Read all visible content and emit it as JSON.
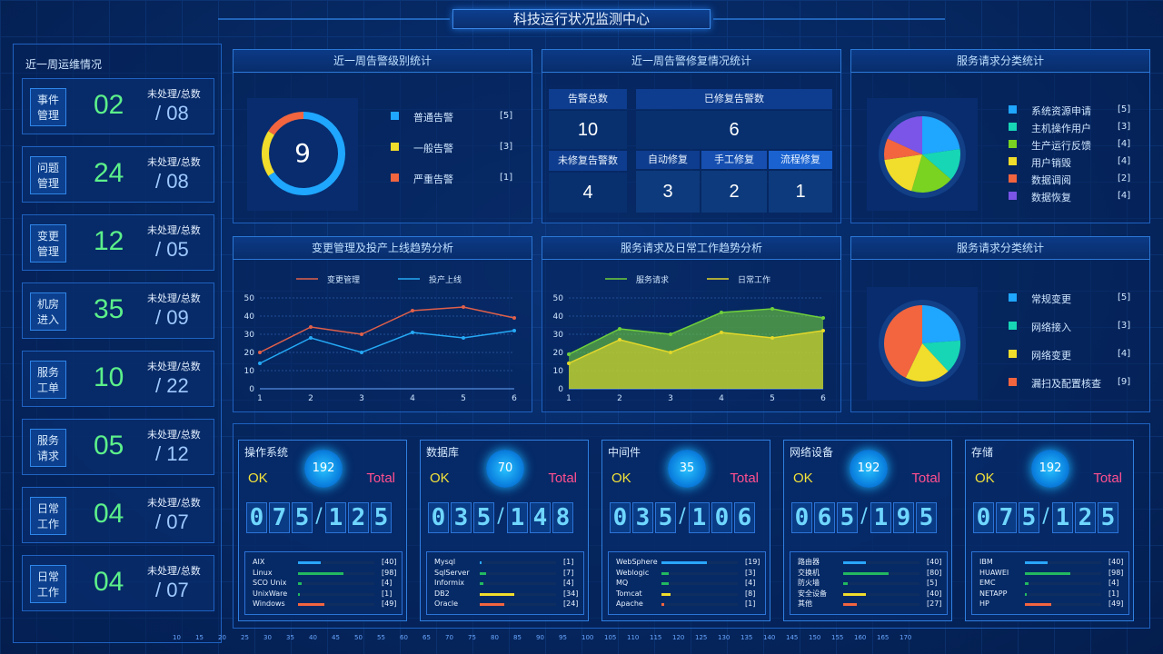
{
  "title": "科技运行状况监测中心",
  "ops": {
    "heading": "近一周运维情况",
    "items": [
      {
        "tag1": "事件",
        "tag2": "管理",
        "open": "02",
        "label": "未处理/总数",
        "total": "/ 08"
      },
      {
        "tag1": "问题",
        "tag2": "管理",
        "open": "24",
        "label": "未处理/总数",
        "total": "/ 08"
      },
      {
        "tag1": "变更",
        "tag2": "管理",
        "open": "12",
        "label": "未处理/总数",
        "total": "/ 05"
      },
      {
        "tag1": "机房",
        "tag2": "进入",
        "open": "35",
        "label": "未处理/总数",
        "total": "/ 09"
      },
      {
        "tag1": "服务",
        "tag2": "工单",
        "open": "10",
        "label": "未处理/总数",
        "total": "/ 22"
      },
      {
        "tag1": "服务",
        "tag2": "请求",
        "open": "05",
        "label": "未处理/总数",
        "total": "/ 12"
      },
      {
        "tag1": "日常",
        "tag2": "工作",
        "open": "04",
        "label": "未处理/总数",
        "total": "/ 07"
      },
      {
        "tag1": "日常",
        "tag2": "工作",
        "open": "04",
        "label": "未处理/总数",
        "total": "/ 07"
      }
    ]
  },
  "alarm_level": {
    "title": "近一周告警级别统计",
    "total": "9",
    "legend": [
      {
        "label": "普通告警",
        "count": "[5]",
        "color": "#1fa6ff"
      },
      {
        "label": "一般告警",
        "count": "[3]",
        "color": "#f1dd2b"
      },
      {
        "label": "严重告警",
        "count": "[1]",
        "color": "#f2653f"
      }
    ]
  },
  "repair": {
    "title": "近一周告警修复情况统计",
    "alarm_total_label": "告警总数",
    "alarm_total": "10",
    "repaired_label": "已修复告警数",
    "repaired": "6",
    "unrepaired_label": "未修复告警数",
    "unrepaired": "4",
    "auto_label": "自动修复",
    "auto": "3",
    "manual_label": "手工修复",
    "manual": "2",
    "flow_label": "流程修复",
    "flow": "1"
  },
  "service_cat1": {
    "title": "服务请求分类统计",
    "legend": [
      {
        "label": "系统资源申请",
        "count": "[5]",
        "color": "#1fa6ff"
      },
      {
        "label": "主机操作用户",
        "count": "[3]",
        "color": "#17d6b5"
      },
      {
        "label": "生产运行反馈",
        "count": "[4]",
        "color": "#7ad320"
      },
      {
        "label": "用户销毁",
        "count": "[4]",
        "color": "#f1dd2b"
      },
      {
        "label": "数据调阅",
        "count": "[2]",
        "color": "#f2653f"
      },
      {
        "label": "数据恢复",
        "count": "[4]",
        "color": "#7a55e8"
      }
    ]
  },
  "change_trend": {
    "title": "变更管理及投产上线趋势分析"
  },
  "service_trend": {
    "title": "服务请求及日常工作趋势分析"
  },
  "service_cat2": {
    "title": "服务请求分类统计",
    "legend": [
      {
        "label": "常规变更",
        "count": "[5]",
        "color": "#1fa6ff"
      },
      {
        "label": "网络接入",
        "count": "[3]",
        "color": "#17d6b5"
      },
      {
        "label": "网络变更",
        "count": "[4]",
        "color": "#f1dd2b"
      },
      {
        "label": "漏扫及配置核查",
        "count": "[9]",
        "color": "#f2653f"
      }
    ]
  },
  "chart_data": [
    {
      "type": "line",
      "title": "变更管理及投产上线趋势分析",
      "x": [
        1,
        2,
        3,
        4,
        5,
        6
      ],
      "ylim": [
        0,
        50
      ],
      "yticks": [
        0,
        10,
        20,
        30,
        40,
        50
      ],
      "series": [
        {
          "name": "变更管理",
          "values": [
            20,
            34,
            30,
            43,
            45,
            39
          ],
          "color": "#e0604a"
        },
        {
          "name": "投产上线",
          "values": [
            14,
            28,
            20,
            31,
            28,
            32
          ],
          "color": "#25a9f5"
        }
      ],
      "legend": "top"
    },
    {
      "type": "area",
      "title": "服务请求及日常工作趋势分析",
      "x": [
        1,
        2,
        3,
        4,
        5,
        6
      ],
      "ylim": [
        0,
        50
      ],
      "yticks": [
        0,
        10,
        20,
        30,
        40,
        50
      ],
      "series": [
        {
          "name": "服务请求",
          "values": [
            19,
            33,
            30,
            42,
            44,
            39
          ],
          "color": "#6fcf3b"
        },
        {
          "name": "日常工作",
          "values": [
            14,
            27,
            20,
            31,
            28,
            32
          ],
          "color": "#e4d82a"
        }
      ],
      "legend": "top"
    },
    {
      "type": "pie",
      "title": "服务请求分类统计",
      "labels": [
        "系统资源申请",
        "主机操作用户",
        "生产运行反馈",
        "用户销毁",
        "数据调阅",
        "数据恢复"
      ],
      "values": [
        5,
        3,
        4,
        4,
        2,
        4
      ]
    },
    {
      "type": "pie",
      "title": "服务请求分类统计",
      "labels": [
        "常规变更",
        "网络接入",
        "网络变更",
        "漏扫及配置核查"
      ],
      "values": [
        5,
        3,
        4,
        9
      ]
    }
  ],
  "cards": [
    {
      "title": "操作系统",
      "ok": "OK",
      "total_label": "Total",
      "count": "192",
      "digits": [
        "0",
        "7",
        "5",
        "/",
        "1",
        "2",
        "5"
      ],
      "items": [
        {
          "name": "AIX",
          "val": "[40]",
          "frac": 0.3,
          "color": "#29a6ff"
        },
        {
          "name": "Linux",
          "val": "[98]",
          "frac": 0.6,
          "color": "#23b860"
        },
        {
          "name": "SCO Unix",
          "val": "[4]",
          "frac": 0.05,
          "color": "#23b860"
        },
        {
          "name": "UnixWare",
          "val": "[1]",
          "frac": 0.02,
          "color": "#23b860"
        },
        {
          "name": "Windows",
          "val": "[49]",
          "frac": 0.35,
          "color": "#f2653f"
        }
      ]
    },
    {
      "title": "数据库",
      "ok": "OK",
      "total_label": "Total",
      "count": "70",
      "digits": [
        "0",
        "3",
        "5",
        "/",
        "1",
        "4",
        "8"
      ],
      "items": [
        {
          "name": "Mysql",
          "val": "[1]",
          "frac": 0.02,
          "color": "#29a6ff"
        },
        {
          "name": "SqlServer",
          "val": "[7]",
          "frac": 0.08,
          "color": "#23b860"
        },
        {
          "name": "Informix",
          "val": "[4]",
          "frac": 0.05,
          "color": "#23b860"
        },
        {
          "name": "DB2",
          "val": "[34]",
          "frac": 0.45,
          "color": "#f1dd2b"
        },
        {
          "name": "Oracle",
          "val": "[24]",
          "frac": 0.32,
          "color": "#f2653f"
        }
      ]
    },
    {
      "title": "中间件",
      "ok": "OK",
      "total_label": "Total",
      "count": "35",
      "digits": [
        "0",
        "3",
        "5",
        "/",
        "1",
        "0",
        "6"
      ],
      "items": [
        {
          "name": "WebSphere",
          "val": "[19]",
          "frac": 0.6,
          "color": "#29a6ff"
        },
        {
          "name": "Weblogic",
          "val": "[3]",
          "frac": 0.1,
          "color": "#23b860"
        },
        {
          "name": "MQ",
          "val": "[4]",
          "frac": 0.1,
          "color": "#23b860"
        },
        {
          "name": "Tomcat",
          "val": "[8]",
          "frac": 0.12,
          "color": "#f1dd2b"
        },
        {
          "name": "Apache",
          "val": "[1]",
          "frac": 0.03,
          "color": "#f2653f"
        }
      ]
    },
    {
      "title": "网络设备",
      "ok": "OK",
      "total_label": "Total",
      "count": "192",
      "digits": [
        "0",
        "6",
        "5",
        "/",
        "1",
        "9",
        "5"
      ],
      "items": [
        {
          "name": "路由器",
          "val": "[40]",
          "frac": 0.3,
          "color": "#29a6ff"
        },
        {
          "name": "交换机",
          "val": "[80]",
          "frac": 0.6,
          "color": "#23b860"
        },
        {
          "name": "防火墙",
          "val": "[5]",
          "frac": 0.06,
          "color": "#23b860"
        },
        {
          "name": "安全设备",
          "val": "[40]",
          "frac": 0.3,
          "color": "#f1dd2b"
        },
        {
          "name": "其他",
          "val": "[27]",
          "frac": 0.18,
          "color": "#f2653f"
        }
      ]
    },
    {
      "title": "存储",
      "ok": "OK",
      "total_label": "Total",
      "count": "192",
      "digits": [
        "0",
        "7",
        "5",
        "/",
        "1",
        "2",
        "5"
      ],
      "items": [
        {
          "name": "IBM",
          "val": "[40]",
          "frac": 0.3,
          "color": "#29a6ff"
        },
        {
          "name": "HUAWEI",
          "val": "[98]",
          "frac": 0.6,
          "color": "#23b860"
        },
        {
          "name": "EMC",
          "val": "[4]",
          "frac": 0.05,
          "color": "#23b860"
        },
        {
          "name": "NETAPP",
          "val": "[1]",
          "frac": 0.02,
          "color": "#23b860"
        },
        {
          "name": "HP",
          "val": "[49]",
          "frac": 0.35,
          "color": "#f2653f"
        }
      ]
    }
  ],
  "scale_ticks": [
    "10",
    "15",
    "20",
    "25",
    "30",
    "35",
    "40",
    "45",
    "50",
    "55",
    "60",
    "65",
    "70",
    "75",
    "80",
    "85",
    "90",
    "95",
    "100",
    "105",
    "110",
    "115",
    "120",
    "125",
    "130",
    "135",
    "140",
    "145",
    "150",
    "155",
    "160",
    "165",
    "170"
  ]
}
